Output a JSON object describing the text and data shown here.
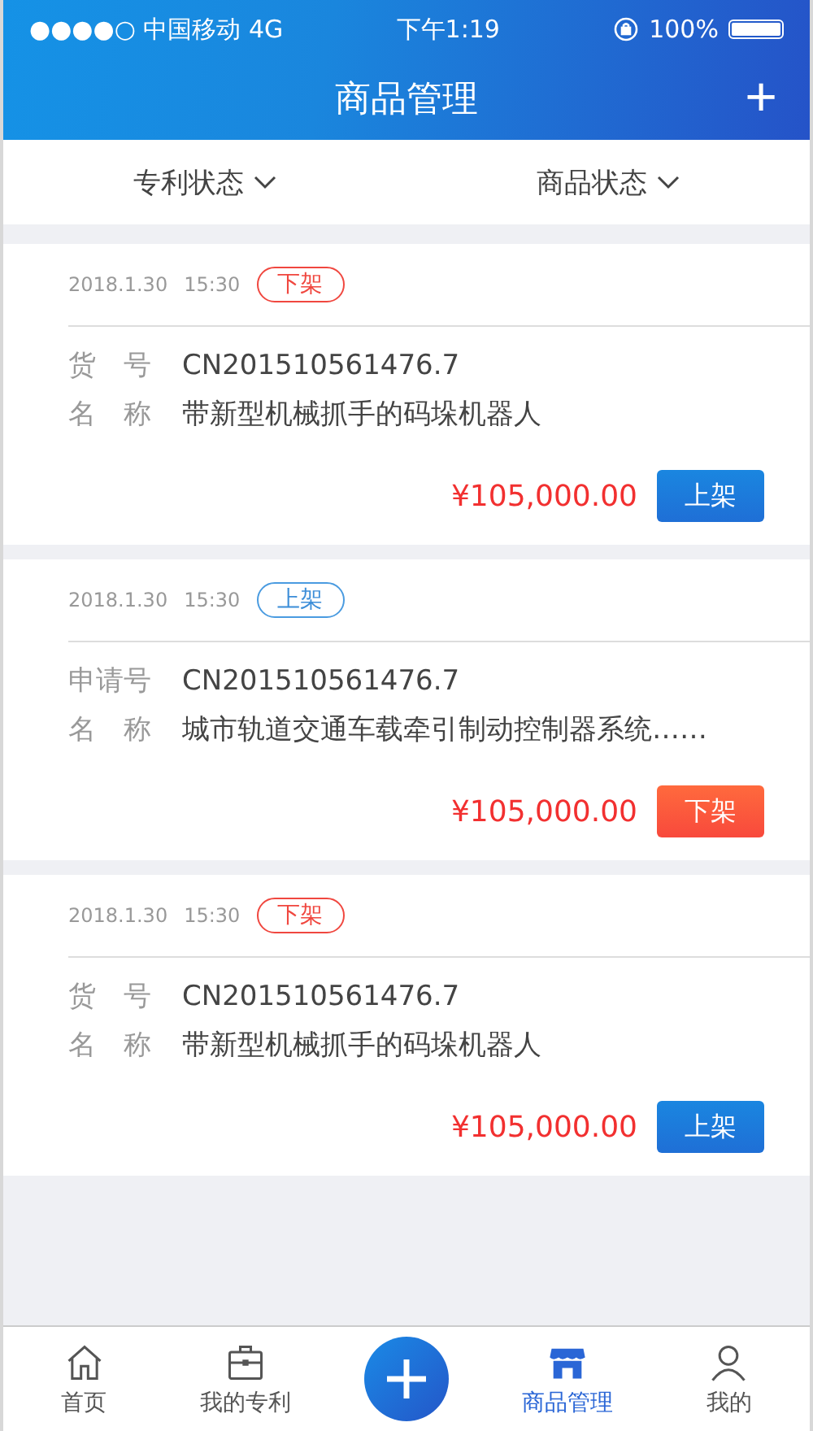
{
  "status_bar": {
    "carrier": "●●●●○ 中国移动 4G",
    "time": "下午1:19",
    "battery": "100%"
  },
  "nav": {
    "title": "商品管理",
    "action": "+"
  },
  "filters": [
    {
      "label": "专利状态"
    },
    {
      "label": "商品状态"
    }
  ],
  "products": [
    {
      "date": "2018.1.30",
      "time": "15:30",
      "status": {
        "text": "下架",
        "kind": "off"
      },
      "fields": [
        {
          "label": "货　号",
          "value": "CN201510561476.7"
        },
        {
          "label": "名　称",
          "value": "带新型机械抓手的码垛机器人"
        }
      ],
      "price": "¥105,000.00",
      "action": {
        "text": "上架",
        "kind": "on"
      }
    },
    {
      "date": "2018.1.30",
      "time": "15:30",
      "status": {
        "text": "上架",
        "kind": "on"
      },
      "fields": [
        {
          "label": "申请号",
          "value": "CN201510561476.7"
        },
        {
          "label": "名　称",
          "value": "城市轨道交通车载牵引制动控制器系统……"
        }
      ],
      "price": "¥105,000.00",
      "action": {
        "text": "下架",
        "kind": "off"
      }
    },
    {
      "date": "2018.1.30",
      "time": "15:30",
      "status": {
        "text": "下架",
        "kind": "off"
      },
      "fields": [
        {
          "label": "货　号",
          "value": "CN201510561476.7"
        },
        {
          "label": "名　称",
          "value": "带新型机械抓手的码垛机器人"
        }
      ],
      "price": "¥105,000.00",
      "action": {
        "text": "上架",
        "kind": "on"
      }
    }
  ],
  "tabbar": [
    {
      "kind": "tab",
      "label": "首页",
      "selected": false
    },
    {
      "kind": "tab",
      "label": "我的专利",
      "selected": false
    },
    {
      "kind": "plus",
      "selected": false
    },
    {
      "kind": "tab",
      "label": "商品管理",
      "selected": true
    },
    {
      "kind": "tab",
      "label": "我的",
      "selected": false
    }
  ]
}
